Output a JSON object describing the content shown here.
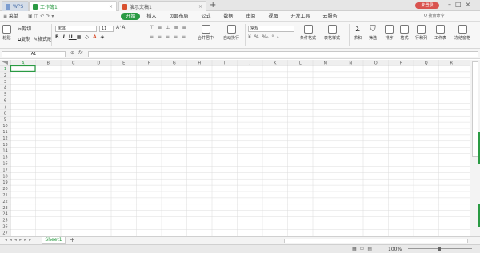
{
  "titlebar": {
    "app_tab": "WPS",
    "tabs": [
      {
        "label": "工作簿1",
        "active": true
      },
      {
        "label": "演示文稿1",
        "active": false
      }
    ],
    "new_tab": "+",
    "login": "未登录"
  },
  "menubar": {
    "file": "≡ 菜单",
    "items": [
      "开始",
      "插入",
      "页面布局",
      "公式",
      "数据",
      "审阅",
      "视图",
      "开发工具",
      "云服务"
    ],
    "search_placeholder": "Q 搜索命令"
  },
  "ribbon": {
    "paste": "粘贴",
    "cut": "剪切",
    "copy": "复制",
    "format_painter": "格式刷",
    "font_name": "宋体",
    "font_size": "11",
    "merge": "合并居中",
    "wrap": "自动换行",
    "number_format": "常规",
    "cond_format": "条件格式",
    "table_style": "表格样式",
    "sum": "求和",
    "filter": "筛选",
    "sort": "排序",
    "format": "格式",
    "rowcol": "行和列",
    "worksheet": "工作表",
    "freeze": "冻结窗格"
  },
  "formula_bar": {
    "cell_ref": "A1",
    "fx": "fx",
    "value": ""
  },
  "grid": {
    "columns": [
      "A",
      "B",
      "C",
      "D",
      "E",
      "F",
      "G",
      "H",
      "I",
      "J",
      "K",
      "L",
      "M",
      "N",
      "O",
      "P",
      "Q",
      "R"
    ],
    "rows": [
      "1",
      "2",
      "3",
      "4",
      "5",
      "6",
      "7",
      "8",
      "9",
      "10",
      "11",
      "12",
      "13",
      "14",
      "15",
      "16",
      "17",
      "18",
      "19",
      "20",
      "21",
      "22",
      "23",
      "24",
      "25",
      "26",
      "27"
    ]
  },
  "sheets": {
    "tabs": [
      "Sheet1"
    ],
    "add": "+"
  },
  "statusbar": {
    "zoom": "100%"
  },
  "colors": {
    "accent": "#2a9a43",
    "ppt": "#d9502e",
    "login_bg": "#d9534f"
  }
}
